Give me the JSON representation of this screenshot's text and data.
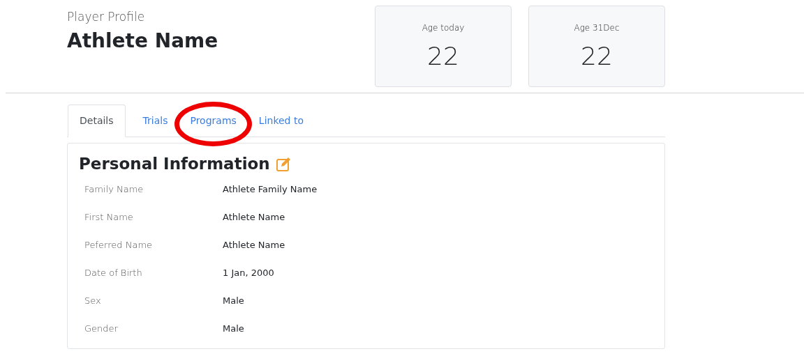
{
  "header": {
    "subtitle": "Player Profile",
    "title": "Athlete Name"
  },
  "stats": [
    {
      "label": "Age today",
      "value": "22"
    },
    {
      "label": "Age 31Dec",
      "value": "22"
    }
  ],
  "tabs": [
    {
      "label": "Details",
      "selected": true,
      "highlighted": false
    },
    {
      "label": "Trials",
      "selected": false,
      "highlighted": false
    },
    {
      "label": "Programs",
      "selected": false,
      "highlighted": true
    },
    {
      "label": "Linked to",
      "selected": false,
      "highlighted": false
    }
  ],
  "section": {
    "title": "Personal Information",
    "fields": [
      {
        "label": "Family Name",
        "value": "Athlete Family Name"
      },
      {
        "label": "First Name",
        "value": "Athlete Name"
      },
      {
        "label": "Peferred Name",
        "value": "Athlete Name"
      },
      {
        "label": "Date of Birth",
        "value": "1 Jan, 2000"
      },
      {
        "label": "Sex",
        "value": "Male"
      },
      {
        "label": "Gender",
        "value": "Male"
      }
    ]
  }
}
